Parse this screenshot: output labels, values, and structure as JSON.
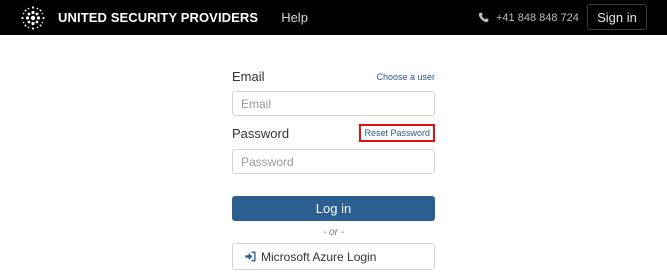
{
  "header": {
    "brand_name": "UNITED SECURITY PROVIDERS",
    "help_label": "Help",
    "phone": "+41 848 848 724",
    "signin_label": "Sign in",
    "logo_icon": "dotted-globe-logo",
    "phone_icon": "phone-icon"
  },
  "login": {
    "email_label": "Email",
    "choose_user_label": "Choose a user",
    "email_placeholder": "Email",
    "email_value": "",
    "password_label": "Password",
    "reset_password_label": "Reset Password",
    "password_placeholder": "Password",
    "password_value": "",
    "login_button_label": "Log in",
    "or_text": "- or -",
    "azure_button_label": "Microsoft Azure Login",
    "azure_icon": "sign-in-icon"
  },
  "colors": {
    "topbar_bg": "#000000",
    "primary_button": "#2b5e91",
    "link": "#2a5b8c",
    "highlight_border": "#e01010"
  }
}
